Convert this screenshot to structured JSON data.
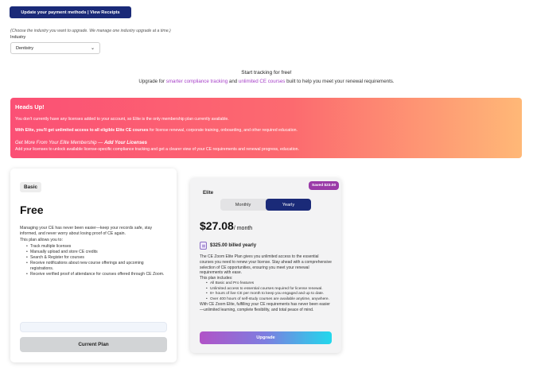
{
  "top": {
    "payment_button": "Update your payment methods | View Receipts",
    "hint": "(Choose the industry you want to upgrade. We manage one industry upgrade at a time.)",
    "industry_label": "Industry",
    "industry_value": "Dentistry"
  },
  "tracking": {
    "title": "Start tracking for free!",
    "sub_prefix": "Upgrade for ",
    "sub_link1": "smarter compliance tracking",
    "sub_and": " and ",
    "sub_link2": "unlimited CE courses",
    "sub_suffix": " built to help you meet your renewal requirements."
  },
  "headsup": {
    "title": "Heads Up!",
    "p1": "You don't currently have any licenses added to your account, so Elite is the only membership plan currently available.",
    "p2_bold": "With Elite, you'll get unlimited access to all eligible Elite CE courses",
    "p2_rest": " for license renewal, corporate training, onboarding, and other required education.",
    "p3_prefix": "Get More From Your Elite Membership — ",
    "p3_bold": "Add Your Licenses",
    "p4": "Add your licenses to unlock available license-specific compliance tracking and get a clearer view of your CE requirements and renewal progress, education."
  },
  "basic": {
    "badge": "Basic",
    "price": "Free",
    "desc": "Managing your CE has never been easier—keep your records safe, stay informed, and never worry about losing proof of CE again.",
    "allows": "This plan allows you to:",
    "items": [
      "Track multiple licenses",
      "Manually upload and store CE credits",
      "Search & Register for courses",
      "Receive notifications about new course offerings and upcoming registrations.",
      "Receive verified proof of attendance for courses offered through CE Zoom."
    ],
    "button": "Current Plan"
  },
  "elite": {
    "saved": "Saved $23.00",
    "name": "Elite",
    "toggle_monthly": "Monthly",
    "toggle_yearly": "Yearly",
    "price": "$27.08",
    "per": "/ month",
    "billed": "$325.00 billed yearly",
    "desc": "The CE Zoom Elite Plan gives you unlimited access to the essential courses you need to renew your license. Stay ahead with a comprehensive selection of CE opportunities, ensuring you meet your renewal requirements with ease.",
    "includes": "This plan includes:",
    "items": [
      "All Basic and Pro features",
      "Unlimited access to essential courses required for license renewal.",
      "8+ hours of live CE per month to keep you engaged and up to date.",
      "Over 400 hours of self-study courses are available anytime, anywhere."
    ],
    "footer": "With CE Zoom Elite, fulfilling your CE requirements has never been easier—unlimited learning, complete flexibility, and total peace of mind.",
    "button": "Upgrade"
  }
}
